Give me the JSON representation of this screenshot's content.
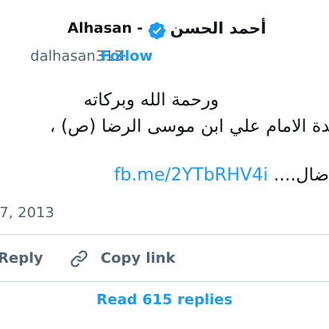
{
  "author": {
    "display_name_en": "Alhasan -",
    "display_name_ar": "أحمد الحسن",
    "handle": "dalhasan313",
    "separator": "·",
    "follow_label": "Follow"
  },
  "tweet": {
    "line1": "ورحمة الله وبركاته",
    "line2": "بدة الامام علي ابن موسى الرضا (ص) ،",
    "line3_link": "fb.me/2YTbRHV4i",
    "line3_text": "ضال.... ",
    "date": "7, 2013"
  },
  "actions": {
    "reply_label": "Reply",
    "copy_link_label": "Copy link",
    "read_replies_label": "Read 615 replies"
  },
  "colors": {
    "accent": "#1d9bf0",
    "text": "#0f1419",
    "muted": "#536471",
    "divider": "#cfd9de"
  }
}
